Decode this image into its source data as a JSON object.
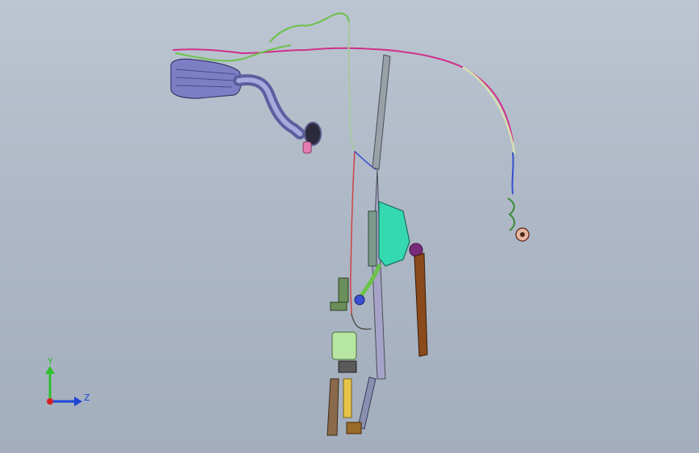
{
  "triad": {
    "y_label": "Y",
    "z_label": "Z",
    "colors": {
      "y": "#2fbf2f",
      "z": "#1e46d6",
      "origin": "#d62020"
    }
  },
  "model_colors": {
    "hose_blue": "#7c7fc4",
    "bracket_teal": "#35d9b0",
    "wire_pink": "#d0308c",
    "wire_green": "#6cc24a",
    "arm_gray": "#8a8f99",
    "blade_brown": "#8a4a1c",
    "motor_green": "#b6e6a2",
    "cable_blue": "#3a4fd0"
  }
}
